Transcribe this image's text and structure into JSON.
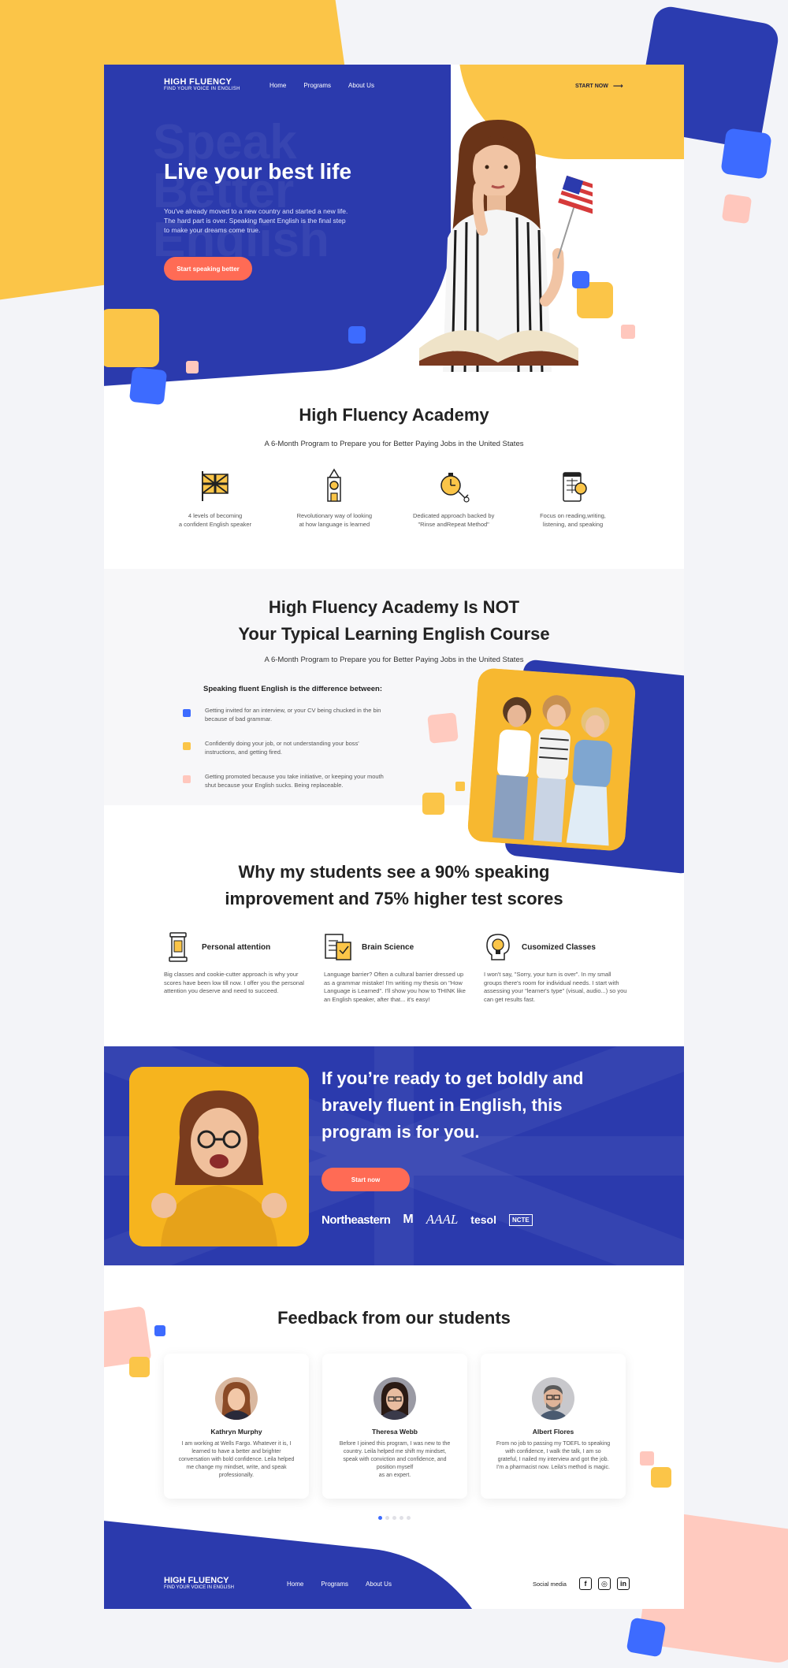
{
  "brand": {
    "name": "HIGH FLUENCY",
    "tagline": "FIND YOUR VOICE IN ENGLISH"
  },
  "nav": {
    "items": [
      "Home",
      "Programs",
      "About Us"
    ],
    "cta_label": "START NOW"
  },
  "hero": {
    "bg_text_1": "Speak",
    "bg_text_2": "Better",
    "bg_text_3": "English",
    "title": "Live your best life",
    "desc_1": "You've already moved to a new country and started a new life.",
    "desc_2": "The hard part is over. Speaking fluent English is the final step",
    "desc_3": "to make your dreams come true.",
    "button": "Start speaking better"
  },
  "academy": {
    "title": "High Fluency Academy",
    "subtitle": "A 6-Month Program to Prepare you for Better Paying Jobs in the United States",
    "features": [
      {
        "icon": "uk-flag-icon",
        "line1": "4 levels of becoming",
        "line2": "a confident English speaker"
      },
      {
        "icon": "big-ben-icon",
        "line1": "Revolutionary way of looking",
        "line2": "at how language is learned"
      },
      {
        "icon": "stopwatch-icon",
        "line1": "Dedicated approach backed by",
        "line2": "\"Rinse andRepeat Method\""
      },
      {
        "icon": "phone-booth-icon",
        "line1": "Focus on reading,writing,",
        "line2": "listening, and speaking"
      }
    ]
  },
  "not_typical": {
    "title_1": "High Fluency Academy Is NOT",
    "title_2": "Your Typical Learning English Course",
    "subtitle": "A 6-Month Program to Prepare you for Better Paying Jobs in the United States",
    "diff_heading": "Speaking fluent English is the difference between:",
    "items": [
      {
        "line1": "Getting invited for an interview, or your CV being chucked in the bin",
        "line2": "because of bad grammar.",
        "color": "#3d6bff"
      },
      {
        "line1": "Confidently doing your job, or not understanding your boss'",
        "line2": "instructions, and getting fired.",
        "color": "#fbc548"
      },
      {
        "line1": "Getting promoted because you take initiative, or keeping your mouth",
        "line2": "shut because your English sucks. Being replaceable.",
        "color": "#ffc7bd"
      }
    ]
  },
  "why": {
    "title_1": "Why my students see a 90% speaking",
    "title_2": "improvement and 75% higher test scores",
    "cols": [
      {
        "icon": "lantern-icon",
        "title": "Personal attention",
        "text": "Big classes and cookie-cutter approach is why your scores have been low till now. I offer you the personal attention you deserve and need to succeed."
      },
      {
        "icon": "brain-checklist-icon",
        "title": "Brain Science",
        "text": "Language barrier? Often a cultural barrier dressed up as a grammar mistake! I'm writing my thesis on \"How Language is Learned\". I'll show you how to THINK like an English speaker, after that... it's easy!"
      },
      {
        "icon": "lightbulb-head-icon",
        "title": "Cusomized Classes",
        "text": "I won't say, \"Sorry, your turn is over\". In my small groups there's room for individual needs. I start with assessing your \"learner's type\" (visual, audio...) so you can get results fast."
      }
    ]
  },
  "cta": {
    "title_1": "If you’re ready to get boldly and",
    "title_2": "bravely fluent in English, this",
    "title_3": "program is for you.",
    "button": "Start now",
    "partners": [
      "Northeastern",
      "M",
      "AAAL",
      "tesol",
      "NCTE"
    ]
  },
  "feedback": {
    "title": "Feedback from our students",
    "cards": [
      {
        "name": "Kathryn Murphy",
        "l1": "I am working at Wells Fargo. Whatever it is, I",
        "l2": "learned to have a better and brighter",
        "l3": "conversation with bold confidence. Leila helped",
        "l4": "me change my mindset, write, and speak",
        "l5": "professionally."
      },
      {
        "name": "Theresa Webb",
        "l1": "Before I joined this program, I was new to the",
        "l2": "country. Leila helped me shift my mindset,",
        "l3": "speak with conviction and confidence, and",
        "l4": "position myself",
        "l5": "as an expert."
      },
      {
        "name": "Albert Flores",
        "l1": "From no job to passing my TOEFL to speaking",
        "l2": "with confidence, I walk the talk, I am so",
        "l3": "grateful, I nailed my interview and got the job.",
        "l4": "I'm a pharmacist now. Leila's method is magic.",
        "l5": ""
      }
    ]
  },
  "footer": {
    "nav": [
      "Home",
      "Programs",
      "About Us"
    ],
    "social_label": "Social media",
    "social": [
      "f",
      "ig",
      "in"
    ]
  },
  "colors": {
    "brand_blue": "#2b3aad",
    "accent_blue": "#3d6bff",
    "yellow": "#fbc548",
    "coral": "#ff6b55",
    "pink": "#ffc7bd"
  }
}
